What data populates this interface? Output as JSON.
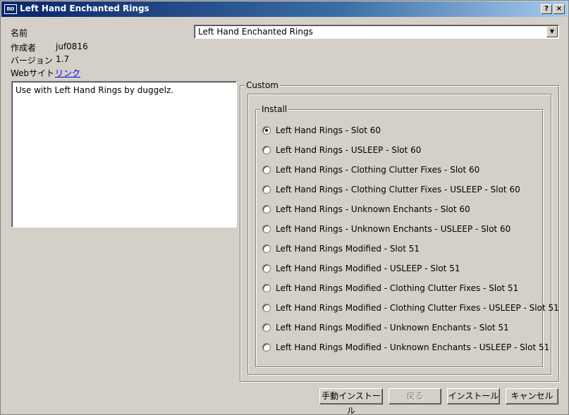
{
  "window": {
    "title": "Left Hand Enchanted Rings",
    "icon_text": "mo",
    "help_button": "?",
    "close_button": "×"
  },
  "info": {
    "name_label": "名前",
    "author_label": "作成者",
    "author_value": "juf0816",
    "version_label": "バージョン",
    "version_value": "1.7",
    "website_label": "Webサイト",
    "website_link": "リンク"
  },
  "name_select": {
    "value": "Left Hand Enchanted Rings"
  },
  "description": "Use with Left Hand Rings by duggelz.",
  "custom_group": {
    "legend": "Custom"
  },
  "install_group": {
    "legend": "Install",
    "options": [
      {
        "label": "Left Hand Rings - Slot 60",
        "checked": true
      },
      {
        "label": "Left Hand Rings - USLEEP - Slot 60",
        "checked": false
      },
      {
        "label": "Left Hand Rings - Clothing Clutter Fixes - Slot 60",
        "checked": false
      },
      {
        "label": "Left Hand Rings - Clothing Clutter Fixes - USLEEP - Slot 60",
        "checked": false
      },
      {
        "label": "Left Hand Rings - Unknown Enchants - Slot 60",
        "checked": false
      },
      {
        "label": "Left Hand Rings - Unknown Enchants - USLEEP - Slot 60",
        "checked": false
      },
      {
        "label": "Left Hand Rings Modified - Slot 51",
        "checked": false
      },
      {
        "label": "Left Hand Rings Modified - USLEEP - Slot 51",
        "checked": false
      },
      {
        "label": "Left Hand Rings Modified - Clothing Clutter Fixes - Slot 51",
        "checked": false
      },
      {
        "label": "Left Hand Rings Modified - Clothing Clutter Fixes - USLEEP - Slot 51",
        "checked": false
      },
      {
        "label": "Left Hand Rings Modified - Unknown Enchants - Slot 51",
        "checked": false
      },
      {
        "label": "Left Hand Rings Modified - Unknown Enchants - USLEEP - Slot 51",
        "checked": false
      }
    ]
  },
  "buttons": {
    "manual_install": "手動インストール",
    "back": "戻る",
    "install": "インストール",
    "cancel": "キャンセル"
  }
}
